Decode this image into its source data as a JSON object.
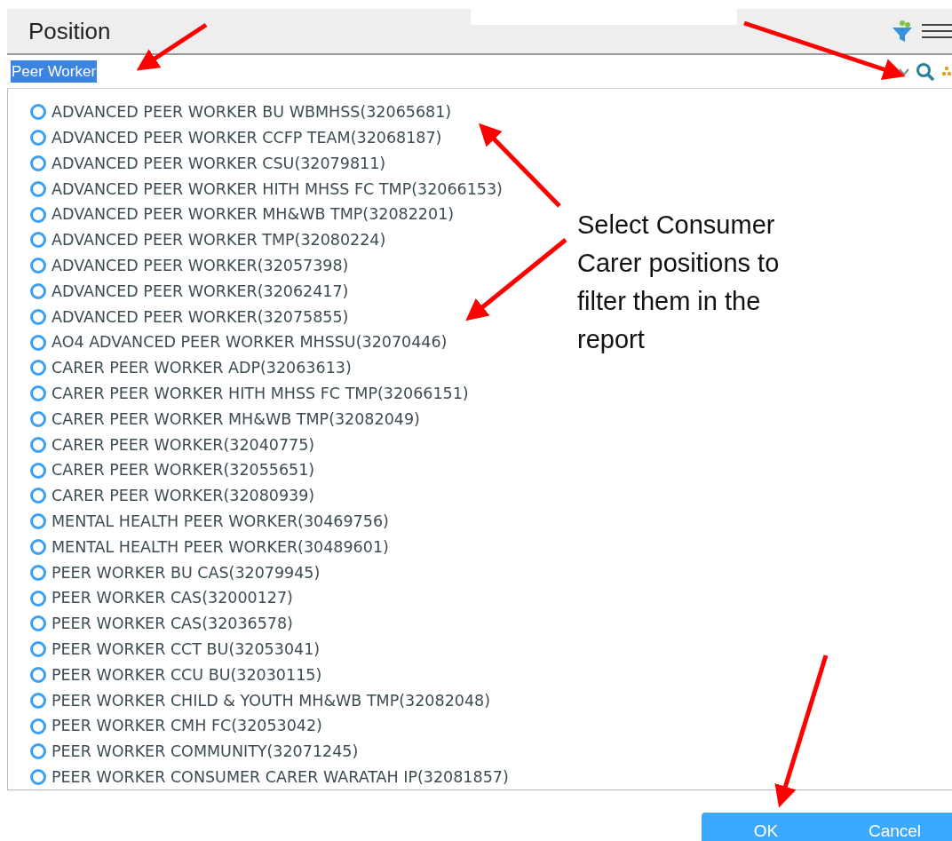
{
  "header": {
    "title": "Position"
  },
  "search": {
    "value": "Peer Worker",
    "text_selected": true
  },
  "positions": [
    {
      "label": "ADVANCED PEER WORKER BU WBMHSS(32065681)",
      "selected": false
    },
    {
      "label": "ADVANCED PEER WORKER CCFP TEAM(32068187)",
      "selected": false
    },
    {
      "label": "ADVANCED PEER WORKER CSU(32079811)",
      "selected": false
    },
    {
      "label": "ADVANCED PEER WORKER HITH MHSS FC TMP(32066153)",
      "selected": false
    },
    {
      "label": "ADVANCED PEER WORKER MH&WB TMP(32082201)",
      "selected": false
    },
    {
      "label": "ADVANCED PEER WORKER TMP(32080224)",
      "selected": false
    },
    {
      "label": "ADVANCED PEER WORKER(32057398)",
      "selected": false
    },
    {
      "label": "ADVANCED PEER WORKER(32062417)",
      "selected": false
    },
    {
      "label": "ADVANCED PEER WORKER(32075855)",
      "selected": false
    },
    {
      "label": "AO4 ADVANCED PEER WORKER MHSSU(32070446)",
      "selected": false
    },
    {
      "label": "CARER PEER WORKER ADP(32063613)",
      "selected": false
    },
    {
      "label": "CARER PEER WORKER HITH MHSS FC TMP(32066151)",
      "selected": false
    },
    {
      "label": "CARER PEER WORKER MH&WB TMP(32082049)",
      "selected": false
    },
    {
      "label": "CARER PEER WORKER(32040775)",
      "selected": false
    },
    {
      "label": "CARER PEER WORKER(32055651)",
      "selected": false
    },
    {
      "label": "CARER PEER WORKER(32080939)",
      "selected": false
    },
    {
      "label": "MENTAL HEALTH PEER WORKER(30469756)",
      "selected": false
    },
    {
      "label": "MENTAL HEALTH PEER WORKER(30489601)",
      "selected": false
    },
    {
      "label": "PEER WORKER BU CAS(32079945)",
      "selected": false
    },
    {
      "label": "PEER WORKER CAS(32000127)",
      "selected": false
    },
    {
      "label": "PEER WORKER CAS(32036578)",
      "selected": false
    },
    {
      "label": "PEER WORKER CCT BU(32053041)",
      "selected": false
    },
    {
      "label": "PEER WORKER CCU BU(32030115)",
      "selected": false
    },
    {
      "label": "PEER WORKER CHILD & YOUTH MH&WB TMP(32082048)",
      "selected": false
    },
    {
      "label": "PEER WORKER CMH FC(32053042)",
      "selected": false
    },
    {
      "label": "PEER WORKER COMMUNITY(32071245)",
      "selected": false
    },
    {
      "label": "PEER WORKER CONSUMER CARER WARATAH IP(32081857)",
      "selected": false
    }
  ],
  "annotation": {
    "text": "Select Consumer Carer positions to filter them in the report"
  },
  "buttons": [
    {
      "label": "OK"
    },
    {
      "label": "Cancel"
    }
  ]
}
